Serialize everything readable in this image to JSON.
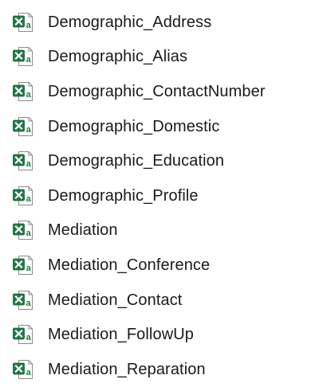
{
  "file_explorer": {
    "icon_type": "excel-csv-icon",
    "colors": {
      "excel_green": "#1f7a45",
      "excel_dark_green": "#185c37",
      "page_outline": "#8a8a8a",
      "text": "#1a1a1a"
    },
    "files": [
      {
        "name": "Demographic_Address"
      },
      {
        "name": "Demographic_Alias"
      },
      {
        "name": "Demographic_ContactNumber"
      },
      {
        "name": "Demographic_Domestic"
      },
      {
        "name": "Demographic_Education"
      },
      {
        "name": "Demographic_Profile"
      },
      {
        "name": "Mediation"
      },
      {
        "name": "Mediation_Conference"
      },
      {
        "name": "Mediation_Contact"
      },
      {
        "name": "Mediation_FollowUp"
      },
      {
        "name": "Mediation_Reparation"
      }
    ]
  }
}
